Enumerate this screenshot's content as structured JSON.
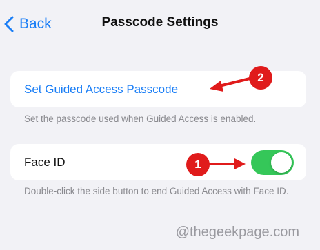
{
  "nav": {
    "back_label": "Back",
    "title": "Passcode Settings"
  },
  "guided_access": {
    "link_label": "Set Guided Access Passcode",
    "footer": "Set the passcode used when Guided Access is enabled."
  },
  "face_id": {
    "label": "Face ID",
    "toggle_on": true,
    "footer": "Double-click the side button to end Guided Access with Face ID."
  },
  "annotations": {
    "badge1": "1",
    "badge2": "2",
    "color": "#e01b1b"
  },
  "watermark": "@thegeekpage.com",
  "colors": {
    "accent": "#1a7ef6",
    "toggle_on": "#35c759",
    "background": "#f2f2f6"
  }
}
